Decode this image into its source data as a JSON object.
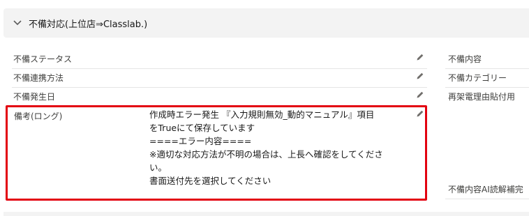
{
  "section": {
    "title": "不備対応(上位店⇒Classlab.)"
  },
  "left_fields": [
    {
      "label": "不備ステータス"
    },
    {
      "label": "不備連携方法"
    },
    {
      "label": "不備発生日"
    }
  ],
  "remarks": {
    "label": "備考(ロング)",
    "lines": [
      "作成時エラー発生 『入力規則無効_動的マニュアル』項目",
      "をTrueにて保存しています",
      "====エラー内容====",
      "※適切な対応方法が不明の場合は、上長へ確認をしてくださ",
      "い。",
      "書面送付先を選択してください"
    ]
  },
  "right_fields": [
    {
      "label": "不備内容"
    },
    {
      "label": "不備カテゴリー"
    },
    {
      "label": "再架電理由貼付用"
    },
    {
      "label": "不備内容AI読解補完"
    }
  ],
  "icons": {
    "chevron": "chevron-down-icon",
    "edit": "pencil-icon"
  },
  "colors": {
    "highlight": "#e3000f",
    "header_bg": "#f3f3f3"
  }
}
